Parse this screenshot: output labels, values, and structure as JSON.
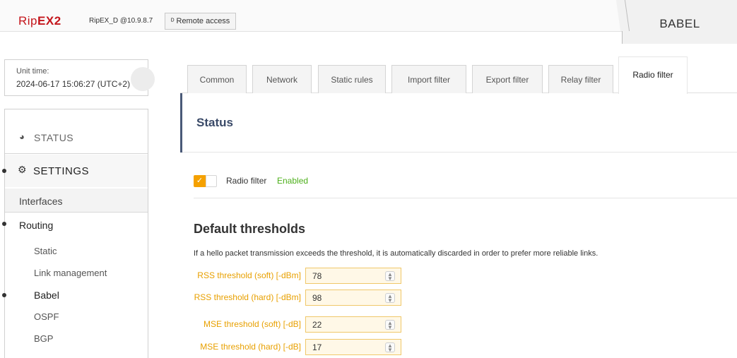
{
  "header": {
    "logo": "RipEX2",
    "device": "RipEX_D @10.9.8.7",
    "remote_icon": "antenna-icon",
    "remote_label": "Remote access",
    "page_title": "BABEL"
  },
  "unit_time": {
    "label": "Unit time:",
    "value": "2024-06-17 15:06:27 (UTC+2)"
  },
  "sidebar": {
    "status_label": "STATUS",
    "status_icon": "gauge-icon",
    "settings_label": "SETTINGS",
    "settings_icon": "gears-icon",
    "items": [
      {
        "label": "Interfaces"
      },
      {
        "label": "Routing"
      },
      {
        "label": "Static"
      },
      {
        "label": "Link management"
      },
      {
        "label": "Babel"
      },
      {
        "label": "OSPF"
      },
      {
        "label": "BGP"
      }
    ]
  },
  "tabs": [
    "Common",
    "Network",
    "Static rules",
    "Import filter",
    "Export filter",
    "Relay filter",
    "Radio filter"
  ],
  "active_tab": "Radio filter",
  "status": {
    "title": "Status",
    "radio_filter_label": "Radio filter",
    "radio_filter_state": "Enabled"
  },
  "thresholds": {
    "title": "Default thresholds",
    "description": "If a hello packet transmission exceeds the threshold, it is automatically discarded in order to prefer more reliable links.",
    "fields": [
      {
        "label": "RSS threshold (soft) [-dBm]",
        "value": "78"
      },
      {
        "label": "RSS threshold (hard) [-dBm]",
        "value": "98"
      },
      {
        "label": "MSE threshold (soft) [-dB]",
        "value": "22"
      },
      {
        "label": "MSE threshold (hard) [-dB]",
        "value": "17"
      }
    ]
  },
  "colors": {
    "accent": "#f5a100",
    "enabled": "#4caf1a",
    "status_title": "#3a4a68",
    "logo": "#c4161c"
  }
}
